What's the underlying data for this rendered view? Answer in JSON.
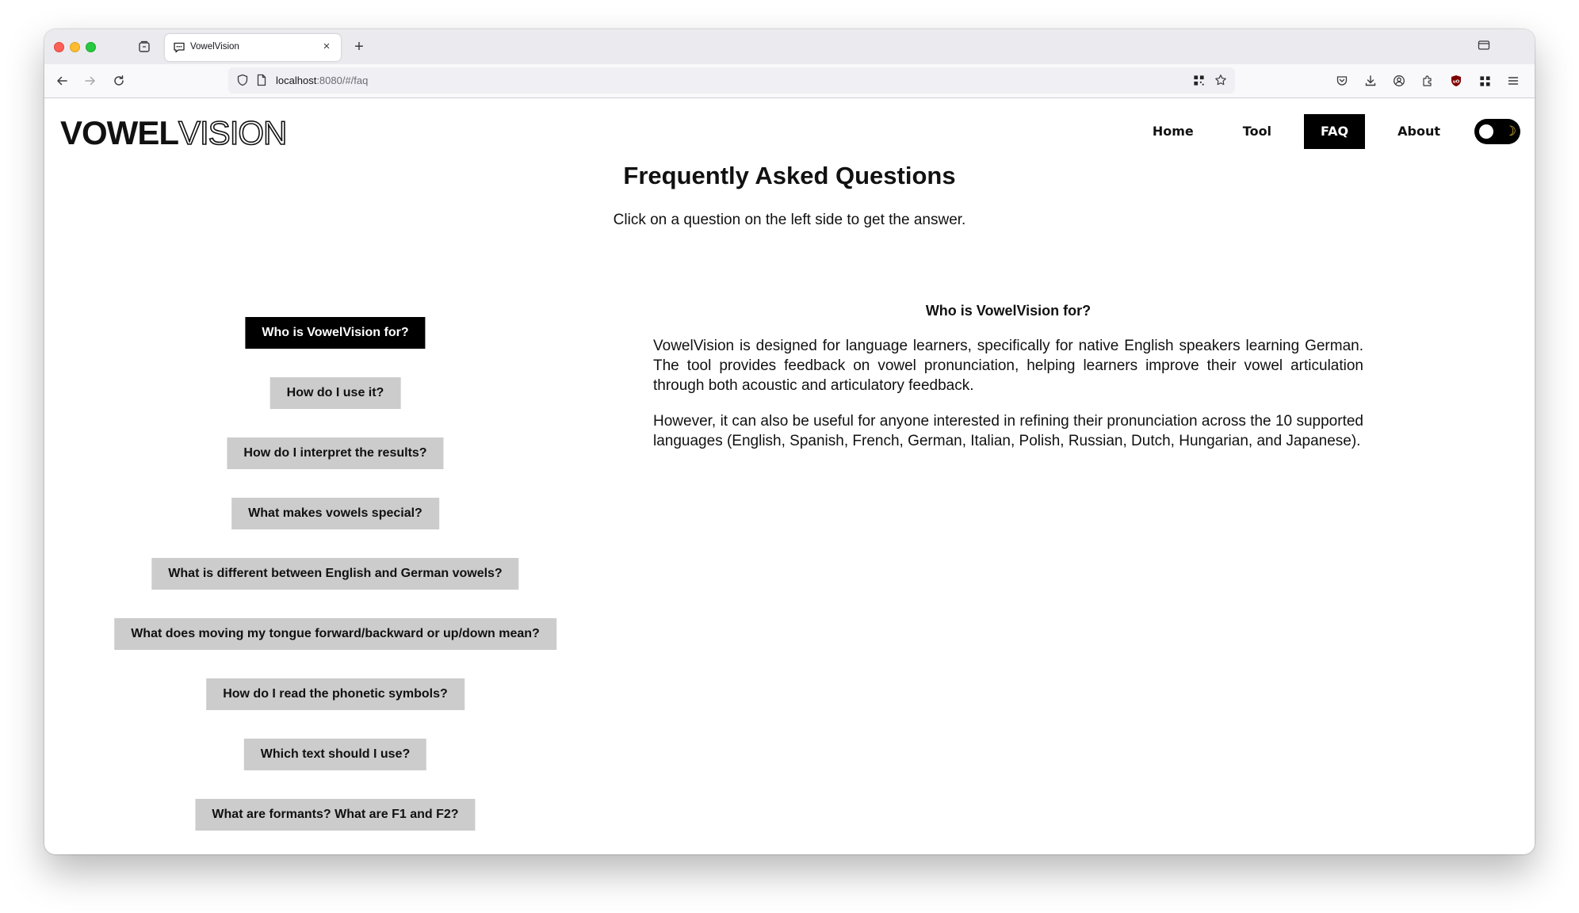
{
  "browser": {
    "tab_title": "VowelVision",
    "url_host": "localhost",
    "url_rest": ":8080/#/faq"
  },
  "site": {
    "logo_bold": "VOWEL",
    "logo_outline": "VISION",
    "nav": [
      "Home",
      "Tool",
      "FAQ",
      "About"
    ],
    "active_nav": "FAQ",
    "theme_toggle_icon": "moon-icon"
  },
  "faq": {
    "title": "Frequently Asked Questions",
    "subtitle": "Click on a question on the left side to get the answer.",
    "questions": [
      "Who is VowelVision for?",
      "How do I use it?",
      "How do I interpret the results?",
      "What makes vowels special?",
      "What is different between English and German vowels?",
      "What does moving my tongue forward/backward or up/down mean?",
      "How do I read the phonetic symbols?",
      "Which text should I use?",
      "What are formants? What are F1 and F2?"
    ],
    "active_question": "Who is VowelVision for?",
    "answer": {
      "title": "Who is VowelVision for?",
      "paragraphs": [
        "VowelVision is designed for language learners, specifically for native English speakers learning German. The tool provides feedback on vowel pronunciation, helping learners improve their vowel articulation through both acoustic and articulatory feedback.",
        "However, it can also be useful for anyone interested in refining their pronunciation across the 10 supported languages (English, Spanish, French, German, Italian, Polish, Russian, Dutch, Hungarian, and Japanese)."
      ]
    }
  },
  "colors": {
    "active_bg": "#000000",
    "button_bg": "#cccccc",
    "moon": "#f3c43a"
  }
}
